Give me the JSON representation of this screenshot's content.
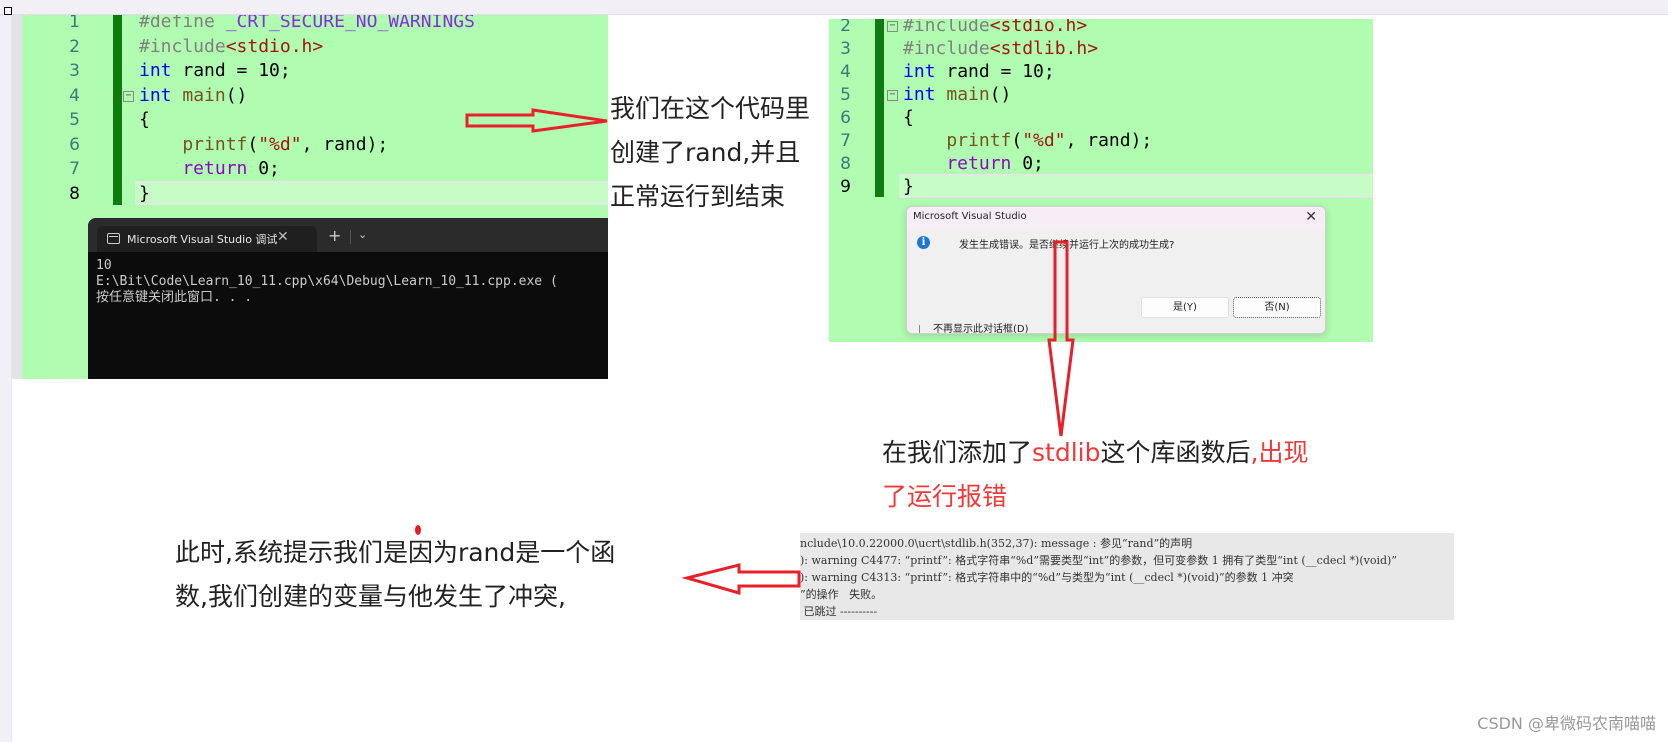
{
  "left_editor": {
    "lines": [
      {
        "num": "1",
        "tokens": [
          {
            "t": "#define ",
            "c": "t-pre"
          },
          {
            "t": "_CRT_SECURE_NO_WARNINGS",
            "c": "t-macro"
          }
        ]
      },
      {
        "num": "2",
        "tokens": [
          {
            "t": "#include",
            "c": "t-pre"
          },
          {
            "t": "<stdio.h>",
            "c": "t-inc"
          }
        ]
      },
      {
        "num": "3",
        "tokens": [
          {
            "t": "int",
            "c": "t-kw"
          },
          {
            "t": " rand = 10;",
            "c": "t-var"
          }
        ]
      },
      {
        "num": "4",
        "tokens": [
          {
            "t": "int",
            "c": "t-kw"
          },
          {
            "t": " main",
            "c": "t-fn"
          },
          {
            "t": "()",
            "c": "t-var"
          }
        ]
      },
      {
        "num": "5",
        "tokens": [
          {
            "t": "{",
            "c": "t-var"
          }
        ]
      },
      {
        "num": "6",
        "tokens": [
          {
            "t": "    printf",
            "c": "t-fn"
          },
          {
            "t": "(",
            "c": "t-var"
          },
          {
            "t": "\"%d\"",
            "c": "t-str"
          },
          {
            "t": ", rand);",
            "c": "t-var"
          }
        ]
      },
      {
        "num": "7",
        "tokens": [
          {
            "t": "    return",
            "c": "t-ctl"
          },
          {
            "t": " 0;",
            "c": "t-var"
          }
        ]
      },
      {
        "num": "8",
        "tokens": [
          {
            "t": "}",
            "c": "t-var"
          }
        ]
      }
    ]
  },
  "terminal": {
    "tab_title": "Microsoft Visual Studio 调试",
    "close_glyph": "✕",
    "new_tab_glyph": "+",
    "dropdown_glyph": "⌄",
    "output": "10\nE:\\Bit\\Code\\Learn_10_11.cpp\\x64\\Debug\\Learn_10_11.cpp.exe (\n按任意键关闭此窗口. . ."
  },
  "note_top": {
    "lines": [
      "我们在这个代码里",
      "创建了rand,并且",
      "正常运行到结束"
    ]
  },
  "right_editor": {
    "lines": [
      {
        "num": "2",
        "tokens": [
          {
            "t": "#include",
            "c": "t-pre"
          },
          {
            "t": "<stdio.h>",
            "c": "t-inc"
          }
        ]
      },
      {
        "num": "3",
        "tokens": [
          {
            "t": "#include",
            "c": "t-pre"
          },
          {
            "t": "<stdlib.h>",
            "c": "t-inc"
          }
        ]
      },
      {
        "num": "4",
        "tokens": [
          {
            "t": "int",
            "c": "t-kw"
          },
          {
            "t": " rand = 10;",
            "c": "t-var"
          }
        ]
      },
      {
        "num": "5",
        "tokens": [
          {
            "t": "int",
            "c": "t-kw"
          },
          {
            "t": " main",
            "c": "t-fn"
          },
          {
            "t": "()",
            "c": "t-var"
          }
        ]
      },
      {
        "num": "6",
        "tokens": [
          {
            "t": "{",
            "c": "t-var"
          }
        ]
      },
      {
        "num": "7",
        "tokens": [
          {
            "t": "    printf",
            "c": "t-fn"
          },
          {
            "t": "(",
            "c": "t-var"
          },
          {
            "t": "\"%d\"",
            "c": "t-str"
          },
          {
            "t": ", rand);",
            "c": "t-var"
          }
        ]
      },
      {
        "num": "8",
        "tokens": [
          {
            "t": "    return",
            "c": "t-ctl"
          },
          {
            "t": " 0;",
            "c": "t-var"
          }
        ]
      },
      {
        "num": "9",
        "tokens": [
          {
            "t": "}",
            "c": "t-var"
          }
        ]
      }
    ]
  },
  "dialog": {
    "title": "Microsoft Visual Studio",
    "close_glyph": "✕",
    "info_glyph": "i",
    "message": "发生生成错误。是否继续并运行上次的成功生成?",
    "yes_label": "是(Y)",
    "no_label": "否(N)",
    "checkbox_label": "不再显示此对话框(D)"
  },
  "note_middle": {
    "line1_black": "在我们添加了",
    "line1_red": "stdlib",
    "line1_black2": "这个库函数后",
    "line1_red2": ",出现",
    "line2_red": "了运行报错"
  },
  "build_output": {
    "lines": [
      "nclude\\10.0.22000.0\\ucrt\\stdlib.h(352,37): message : 参见“rand”的声明",
      "): warning C4477: “printf”: 格式字符串“%d”需要类型“int”的参数，但可变参数 1 拥有了类型“int (__cdecl *)(void)”",
      "): warning C4313: “printf”: 格式字符串中的“%d”与类型为“int (__cdecl *)(void)”的参数 1 冲突",
      "”的操作   失败。",
      " 已跳过 ----------"
    ]
  },
  "note_bottom": {
    "lines": [
      "此时,系统提示我们是因为rand是一个函",
      "数,我们创建的变量与他发生了冲突,"
    ]
  },
  "watermark": "CSDN @卑微码农南喵喵",
  "colors": {
    "editor_bg": "#b0fcb0",
    "change_bar": "#107c10",
    "annotation_red": "#f03a3a",
    "arrow_red": "#e8202a"
  }
}
